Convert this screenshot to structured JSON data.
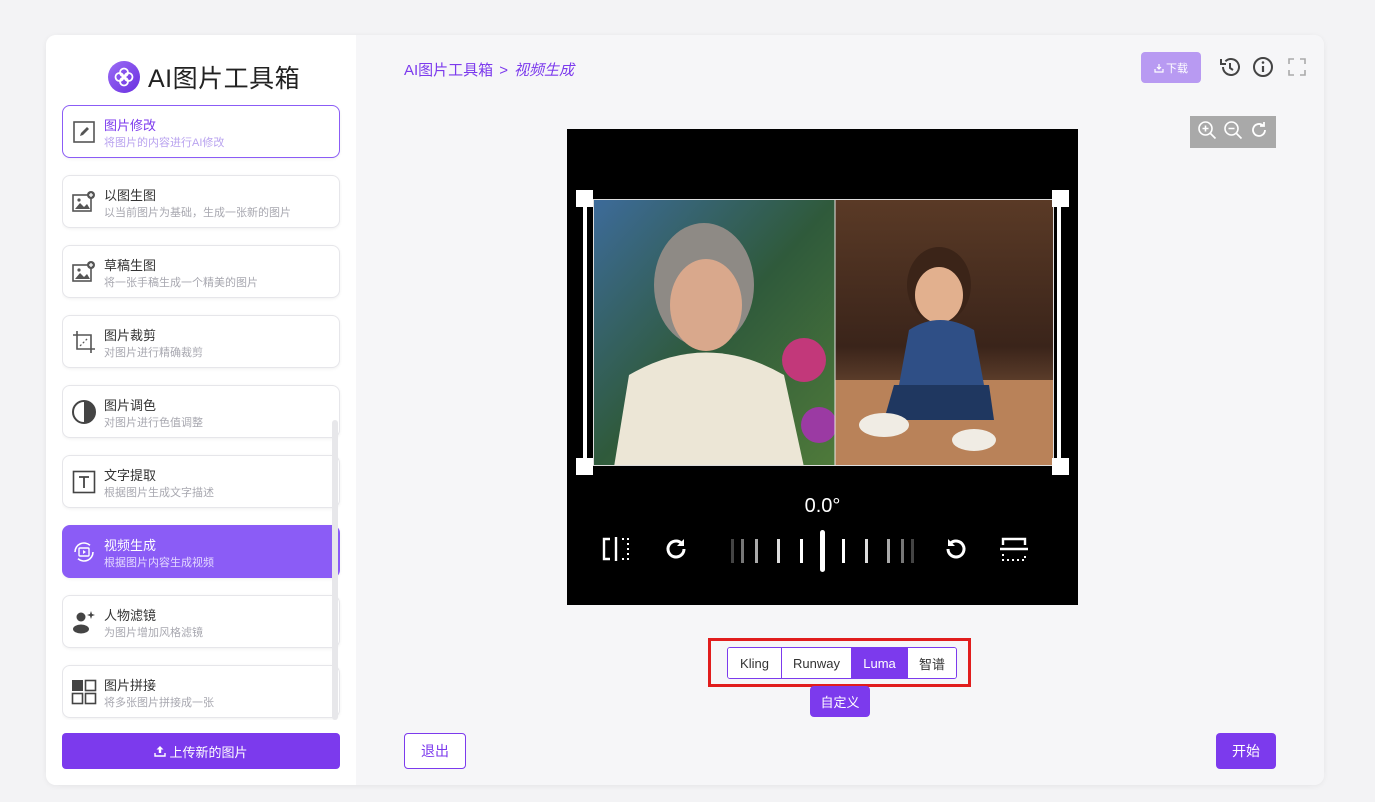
{
  "app": {
    "title": "AI图片工具箱",
    "accent": "#7c3aed",
    "highlight": "#e11d1d"
  },
  "sidebar": {
    "items": [
      {
        "title": "图片修改",
        "desc": "将图片的内容进行AI修改",
        "icon": "edit-icon"
      },
      {
        "title": "以图生图",
        "desc": "以当前图片为基础，生成一张新的图片",
        "icon": "image-plus-icon"
      },
      {
        "title": "草稿生图",
        "desc": "将一张手稿生成一个精美的图片",
        "icon": "image-plus-icon"
      },
      {
        "title": "图片裁剪",
        "desc": "对图片进行精确裁剪",
        "icon": "crop-icon"
      },
      {
        "title": "图片调色",
        "desc": "对图片进行色值调整",
        "icon": "contrast-icon"
      },
      {
        "title": "文字提取",
        "desc": "根据图片生成文字描述",
        "icon": "text-icon"
      },
      {
        "title": "视频生成",
        "desc": "根据图片内容生成视频",
        "icon": "video-icon"
      },
      {
        "title": "人物滤镜",
        "desc": "为图片增加风格滤镜",
        "icon": "person-sparkle-icon"
      },
      {
        "title": "图片拼接",
        "desc": "将多张图片拼接成一张",
        "icon": "grid-icon"
      }
    ],
    "upload_label": "上传新的图片"
  },
  "header": {
    "breadcrumb_root": "AI图片工具箱",
    "breadcrumb_sep": ">",
    "breadcrumb_current": "视频生成",
    "download_label": "下载"
  },
  "editor": {
    "rotation_angle": "0.0°"
  },
  "models": {
    "tabs": [
      "Kling",
      "Runway",
      "Luma",
      "智谱"
    ],
    "selected": "Luma",
    "custom_label": "自定义"
  },
  "footer": {
    "exit_label": "退出",
    "start_label": "开始"
  }
}
